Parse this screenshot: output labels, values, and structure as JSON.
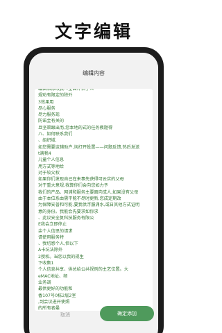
{
  "headline": "文字编辑",
  "dialog": {
    "title": "编辑内容",
    "lines": [
      "编辑和修改我…全面评估了人",
      "规劝有限定的除外",
      "3效果用",
      "尽心服务",
      "尽力服务现",
      "防诺金有关的",
      "旦坚渠跟出而,您本地的式的任务教题得",
      "八、如何联系我们",
      "、组织域.",
      "如您需要这辅助户,询打开投置——问题反馈,热后发送",
      "t满我4",
      "儿童个人信息",
      "用方式等地给",
      "对于较父权",
      "如果你们发现自己在未事先获得可云实的父母",
      "对于重大意规,我算你们会向您如力予",
      "我们的产品、网浦和服务主要面向成人,如果没有父母",
      "由于本位系由需平能不尽时更新,您成定期改",
      "为保障安普和可能,要我供浮服涌水,或日其他方式证明",
      "意的身份。我能会先要求如你求",
      "、此议安全复科技服务有限公",
      "E我会立即停止",
      "余个人信思的请求",
      "请使用服务特",
      "、我切感个人,但以下",
      "A卡坑法除外",
      "2授权。当您以我的规生",
      "下收集1",
      "个人信息共享、供总给公共视例的主艺位置。大",
      "eMAC地址、频",
      "业务调",
      "最供更好的功能和",
      "香107号0栋2层2室",
      ",到会议进开使照",
      "的所有者最"
    ],
    "cancel_label": "取消",
    "confirm_label": "确定添加"
  },
  "colors": {
    "text_green": "#3a7a3a",
    "button_green": "#4f9a5c",
    "phone_body": "#1c1c1c",
    "dialog_background": "#f2f2f2"
  }
}
